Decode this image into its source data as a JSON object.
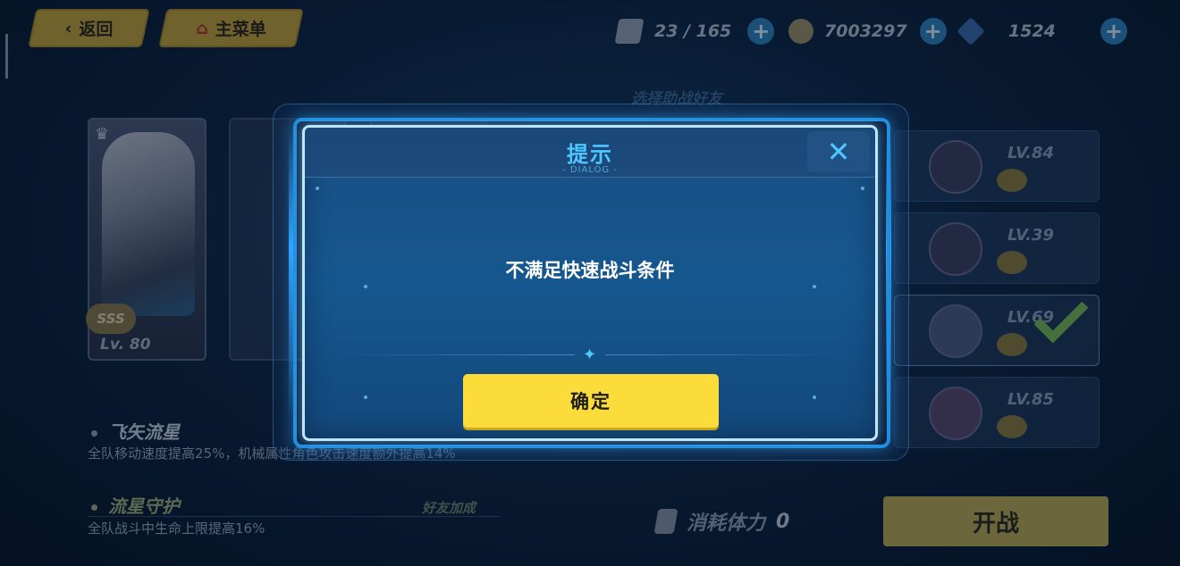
{
  "top_bar": {
    "back_label": "返回",
    "back_icon": "chevron-left-icon",
    "menu_label": "主菜单",
    "menu_icon": "home-icon",
    "stamina": "23 / 165",
    "coins": "7003297",
    "crystals": "1524",
    "plus_symbol": "+"
  },
  "character": {
    "level": "Lv. 80",
    "rank": "SSS"
  },
  "friend_list": {
    "title": "选择助战好友",
    "friends": [
      {
        "level": "LV.84",
        "selected": false
      },
      {
        "level": "LV.39",
        "selected": false
      },
      {
        "level": "LV.69",
        "selected": true
      },
      {
        "level": "LV.85",
        "selected": false
      }
    ]
  },
  "skills": [
    {
      "name": "飞矢流星",
      "description": "全队移动速度提高25%，机械属性角色攻击速度额外提高14%"
    },
    {
      "name": "流星守护",
      "description": "全队战斗中生命上限提高16%"
    }
  ],
  "friend_bonus_label": "好友加成",
  "stamina_cost": {
    "label": "消耗体力",
    "value": "0"
  },
  "start_button": "开战",
  "dialog": {
    "title": "提示",
    "subtitle": "- DIALOG -",
    "close_symbol": "✕",
    "message": "不满足快速战斗条件",
    "confirm_label": "确定",
    "star_symbol": "✦"
  },
  "colors": {
    "dialog_title": "#4fc6ff",
    "confirm_button": "#fcdc3a",
    "dialog_border": "#bfe6ff"
  }
}
